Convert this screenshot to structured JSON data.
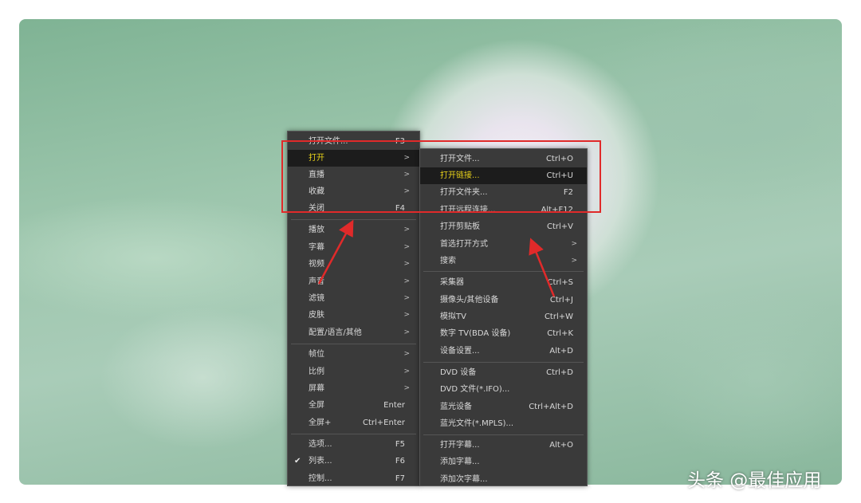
{
  "main_menu": {
    "items": [
      {
        "label": "打开文件...",
        "shortcut": "F3"
      },
      {
        "label": "打开",
        "arrow": ">"
      },
      {
        "label": "直播",
        "arrow": ">"
      },
      {
        "label": "收藏",
        "arrow": ">"
      },
      {
        "label": "关闭",
        "shortcut": "F4"
      },
      {
        "label": "播放",
        "arrow": ">"
      },
      {
        "label": "字幕",
        "arrow": ">"
      },
      {
        "label": "视频",
        "arrow": ">"
      },
      {
        "label": "声音",
        "arrow": ">"
      },
      {
        "label": "滤镜",
        "arrow": ">"
      },
      {
        "label": "皮肤",
        "arrow": ">"
      },
      {
        "label": "配置/语言/其他",
        "arrow": ">"
      },
      {
        "label": "帧位",
        "arrow": ">"
      },
      {
        "label": "比例",
        "arrow": ">"
      },
      {
        "label": "屏幕",
        "arrow": ">"
      },
      {
        "label": "全屏",
        "shortcut": "Enter"
      },
      {
        "label": "全屏+",
        "shortcut": "Ctrl+Enter"
      },
      {
        "label": "选项...",
        "shortcut": "F5"
      },
      {
        "label": "列表...",
        "shortcut": "F6",
        "check": "✔"
      },
      {
        "label": "控制...",
        "shortcut": "F7"
      }
    ]
  },
  "sub_menu": {
    "items": [
      {
        "label": "打开文件...",
        "shortcut": "Ctrl+O"
      },
      {
        "label": "打开链接...",
        "shortcut": "Ctrl+U"
      },
      {
        "label": "打开文件夹...",
        "shortcut": "F2"
      },
      {
        "label": "打开远程连接...",
        "shortcut": "Alt+F12"
      },
      {
        "label": "打开剪贴板",
        "shortcut": "Ctrl+V"
      },
      {
        "label": "首选打开方式",
        "arrow": ">"
      },
      {
        "label": "搜索",
        "arrow": ">"
      },
      {
        "label": "采集器",
        "shortcut": "Ctrl+S"
      },
      {
        "label": "摄像头/其他设备",
        "shortcut": "Ctrl+J"
      },
      {
        "label": "模拟TV",
        "shortcut": "Ctrl+W"
      },
      {
        "label": "数字 TV(BDA 设备)",
        "shortcut": "Ctrl+K"
      },
      {
        "label": "设备设置...",
        "shortcut": "Alt+D"
      },
      {
        "label": "DVD 设备",
        "shortcut": "Ctrl+D"
      },
      {
        "label": "DVD 文件(*.IFO)..."
      },
      {
        "label": "蓝光设备",
        "shortcut": "Ctrl+Alt+D"
      },
      {
        "label": "蓝光文件(*.MPLS)..."
      },
      {
        "label": "打开字幕...",
        "shortcut": "Alt+O"
      },
      {
        "label": "添加字幕..."
      },
      {
        "label": "添加次字幕..."
      }
    ]
  },
  "watermark": "头条 @最佳应用",
  "colors": {
    "highlight_text": "#e8d21a",
    "annotation": "#e02a2a",
    "menu_bg": "#3a3a3a"
  },
  "icons": {
    "check": "check-icon",
    "submenu": "chevron-right-icon"
  }
}
